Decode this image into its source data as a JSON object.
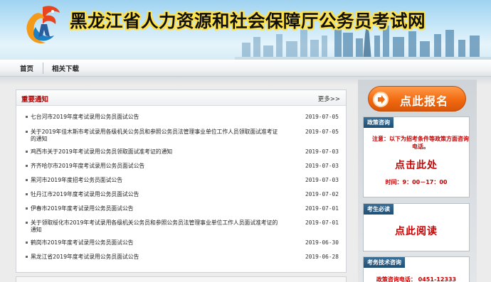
{
  "site": {
    "title": "黑龙江省人力资源和社会保障厅公务员考试网"
  },
  "nav": {
    "items": [
      {
        "label": "首页"
      },
      {
        "label": "相关下载"
      }
    ]
  },
  "notices": {
    "title": "重要通知",
    "more_label": "更多>>",
    "items": [
      {
        "title": "七台河市2019年度考试录用公务员面试公告",
        "date": "2019-07-05"
      },
      {
        "title": "关于2019年佳木斯市考试录用各级机关公务员和参照公务员法管理事业单位工作人员领取面试准考证的通知",
        "date": "2019-07-05"
      },
      {
        "title": "鸡西市关于2019年考试录用公务员领取面试准考证的通知",
        "date": "2019-07-03"
      },
      {
        "title": "齐齐哈尔市2019年度考试录用公务员面试公告",
        "date": "2019-07-03"
      },
      {
        "title": "黑河市2019年度招考公务员面试公告",
        "date": "2019-07-03"
      },
      {
        "title": "牡丹江市2019年度考试录用公务员面试公告",
        "date": "2019-07-02"
      },
      {
        "title": "伊春市2019年度考试录用公务员面试公告",
        "date": "2019-07-01"
      },
      {
        "title": "关于领取绥化市2019年考试录用各级机关公务员和参照公务员法管理事业单位工作人员面试准考证的通知",
        "date": "2019-07-01"
      },
      {
        "title": "鹤岗市2019年度考试录用公务员面试公告",
        "date": "2019-06-30"
      },
      {
        "title": "黑龙江省2019年度考试录用公务员面试公告",
        "date": "2019-06-28"
      }
    ]
  },
  "sidebar": {
    "signup_label": "点此报名",
    "policy": {
      "title": "政策咨询",
      "note": "注意：以下为招考条件等政策方面咨询电话。",
      "link_label": "点击此处",
      "hours": "时间：9：00－17：00"
    },
    "must_read": {
      "title": "考生必读",
      "link_label": "点此阅读"
    },
    "tech": {
      "title": "考务技术咨询",
      "phone_line": "政策咨询电话： 0451-12333"
    }
  },
  "colors": {
    "accent_red": "#b30000",
    "signup_orange": "#f26a10",
    "box_header_blue": "#1f4e74"
  },
  "icons": {
    "logo": "dragon-logo-icon",
    "signup": "arrow-circle-icon"
  }
}
